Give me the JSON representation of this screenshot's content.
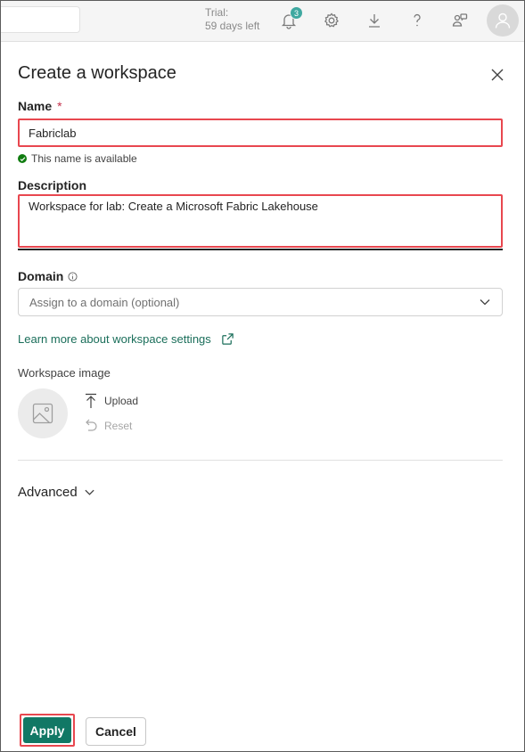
{
  "topbar": {
    "trial_line1": "Trial:",
    "trial_line2": "59 days left",
    "notification_count": "3",
    "icons": [
      "bell-icon",
      "gear-icon",
      "download-icon",
      "help-icon",
      "share-icon",
      "avatar-icon"
    ]
  },
  "panel": {
    "title": "Create a workspace",
    "name": {
      "label": "Name",
      "required_mark": "*",
      "value": "Fabriclab",
      "status": "This name is available"
    },
    "description": {
      "label": "Description",
      "value": "Workspace for lab: Create a Microsoft Fabric Lakehouse"
    },
    "domain": {
      "label": "Domain",
      "placeholder": "Assign to a domain (optional)"
    },
    "learn_more": "Learn more about workspace settings",
    "workspace_image": {
      "label": "Workspace image",
      "upload": "Upload",
      "reset": "Reset"
    },
    "advanced": "Advanced"
  },
  "footer": {
    "apply": "Apply",
    "cancel": "Cancel"
  },
  "colors": {
    "accent": "#117865",
    "highlight": "#e8474f",
    "success": "#107c10",
    "link": "#1a6e5a"
  }
}
